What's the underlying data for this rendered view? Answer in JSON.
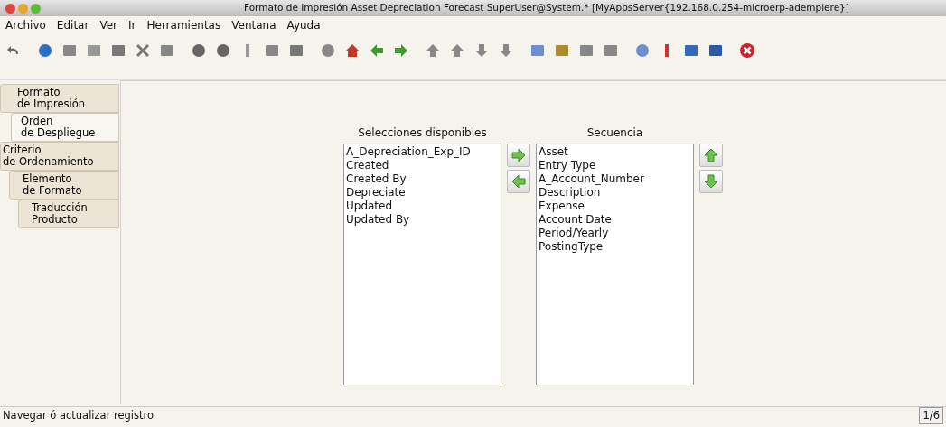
{
  "window": {
    "title": "Formato de Impresión  Asset Depreciation Forecast  SuperUser@System.* [MyAppsServer{192.168.0.254-microerp-adempiere}]"
  },
  "menu": [
    "Archivo",
    "Editar",
    "Ver",
    "Ir",
    "Herramientas",
    "Ventana",
    "Ayuda"
  ],
  "tabs": [
    {
      "label": "Formato\nde Impresión",
      "selected": false
    },
    {
      "label": "Orden\nde Despliegue",
      "selected": true
    },
    {
      "label": "Criterio\nde Ordenamiento",
      "selected": false
    },
    {
      "label": "Elemento\nde Formato",
      "selected": false
    },
    {
      "label": "Traducción\nProducto",
      "selected": false
    }
  ],
  "available": {
    "title": "Selecciones disponibles",
    "items": [
      "A_Depreciation_Exp_ID",
      "Created",
      "Created By",
      "Depreciate",
      "Updated",
      "Updated By"
    ]
  },
  "sequence": {
    "title": "Secuencia",
    "items": [
      "Asset",
      "Entry Type",
      "A_Account_Number",
      "Description",
      "Expense",
      "Account Date",
      "Period/Yearly",
      "PostingType"
    ]
  },
  "status_bar": {
    "message": "Navegar ó actualizar registro",
    "record": "1/6"
  }
}
